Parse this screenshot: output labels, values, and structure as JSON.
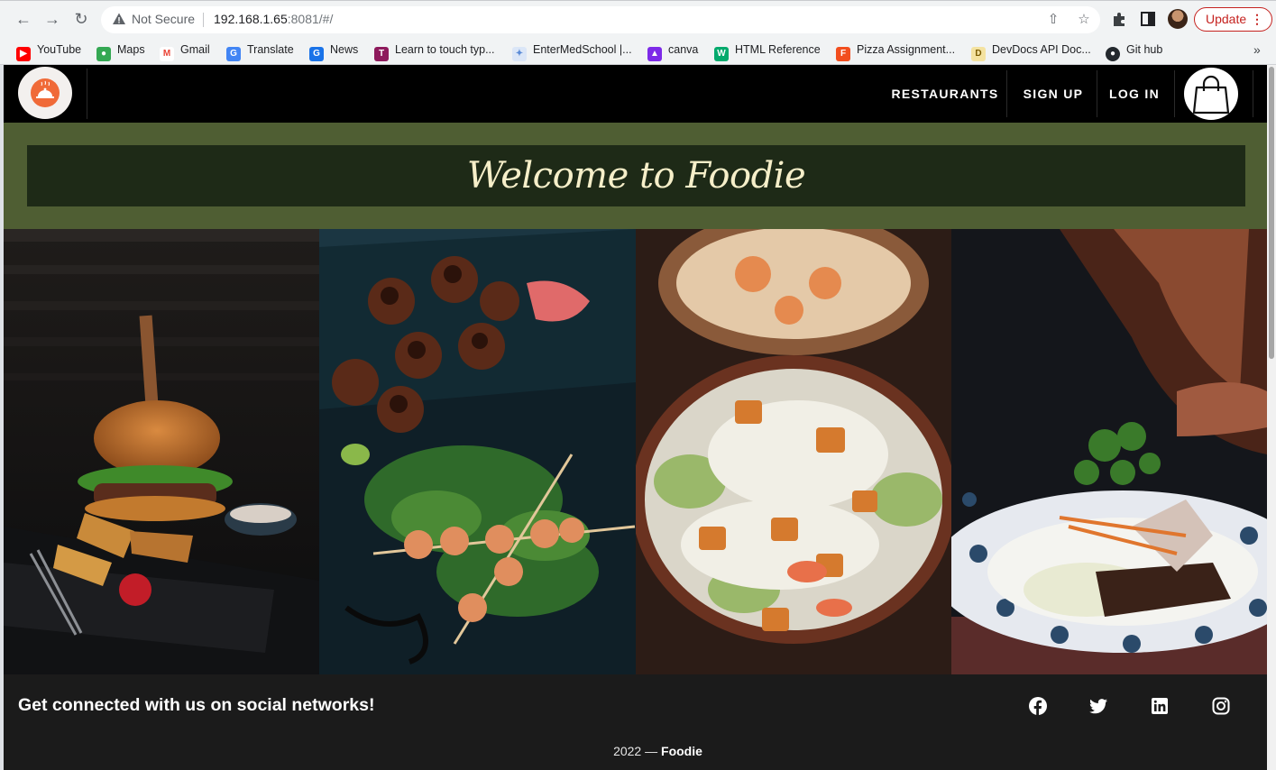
{
  "browser": {
    "security_label": "Not Secure",
    "url_host": "192.168.1.65",
    "url_rest": ":8081/#/",
    "update_label": "Update",
    "bookmarks": [
      {
        "label": "YouTube",
        "icon": "youtube-icon",
        "color": "#ff0000"
      },
      {
        "label": "Maps",
        "icon": "maps-icon",
        "color": "#34a853"
      },
      {
        "label": "Gmail",
        "icon": "gmail-icon",
        "color": "#ea4335"
      },
      {
        "label": "Translate",
        "icon": "translate-icon",
        "color": "#4285f4"
      },
      {
        "label": "News",
        "icon": "news-icon",
        "color": "#1a73e8"
      },
      {
        "label": "Learn to touch typ...",
        "icon": "typing-icon",
        "color": "#8e1a5c"
      },
      {
        "label": "EnterMedSchool |...",
        "icon": "entermedschool-icon",
        "color": "#5b8bd6"
      },
      {
        "label": "canva",
        "icon": "canva-icon",
        "color": "#7d2ae8"
      },
      {
        "label": "HTML Reference",
        "icon": "w3-icon",
        "color": "#04aa6d"
      },
      {
        "label": "Pizza Assignment...",
        "icon": "figma-icon",
        "color": "#f24e1e"
      },
      {
        "label": "DevDocs API Doc...",
        "icon": "devdocs-icon",
        "color": "#d9a400"
      },
      {
        "label": "Git hub",
        "icon": "github-icon",
        "color": "#24292e"
      }
    ]
  },
  "site": {
    "nav": {
      "links": [
        "RESTAURANTS",
        "SIGN UP",
        "LOG IN"
      ]
    },
    "hero": {
      "title": "Welcome to Foodie"
    },
    "gallery": [
      {
        "name": "burger-photo"
      },
      {
        "name": "skewers-photo"
      },
      {
        "name": "salad-photo"
      },
      {
        "name": "fish-plate-photo"
      }
    ],
    "footer": {
      "tagline": "Get connected with us on social networks!",
      "social": [
        "facebook-icon",
        "twitter-icon",
        "linkedin-icon",
        "instagram-icon"
      ],
      "year": "2022 —",
      "brand": "Foodie"
    }
  },
  "colors": {
    "navbar": "#000000",
    "hero_band": "#4f5e33",
    "hero_box": "#1e2a17",
    "hero_text": "#f6efc9",
    "footer": "#1b1b1b",
    "logo_accent": "#f06a38"
  }
}
